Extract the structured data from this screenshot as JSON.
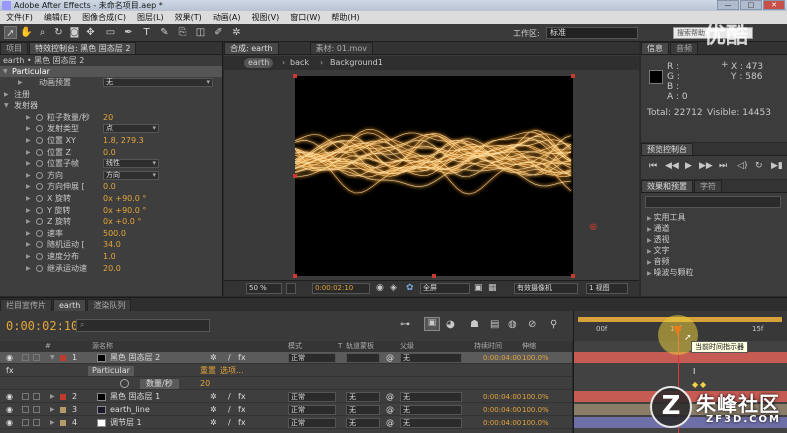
{
  "window": {
    "title": "Adobe After Effects - 未命名项目.aep *",
    "buttons": [
      "—",
      "□",
      "✕"
    ]
  },
  "menu": [
    "文件(F)",
    "编辑(E)",
    "图像合成(C)",
    "图层(L)",
    "效果(T)",
    "动画(A)",
    "视图(V)",
    "窗口(W)",
    "帮助(H)"
  ],
  "toolbar": {
    "tools": [
      "select-tool",
      "hand-tool",
      "zoom-tool",
      "rotate-tool",
      "camera-tool",
      "pan-behind-tool",
      "mask-tool",
      "pen-tool",
      "text-tool",
      "brush-tool",
      "clone-tool",
      "eraser-tool",
      "roto-brush-tool",
      "puppet-tool"
    ],
    "workspace_label": "工作区:",
    "workspace_value": "标准",
    "search_placeholder": "搜索帮助"
  },
  "effect_controls": {
    "tabs": [
      "项目",
      "特效控制台: 黑色 固态层 2"
    ],
    "subheader": "earth • 黑色 固态层 2",
    "effect_name": "Particular",
    "rows": [
      {
        "label": "动画预置",
        "value": "无",
        "kind": "dropdown"
      },
      {
        "label": "注册",
        "value": "",
        "kind": "group"
      },
      {
        "label": "发射器",
        "value": "",
        "kind": "group"
      },
      {
        "label": "粒子数量/秒",
        "value": "20",
        "kind": "value"
      },
      {
        "label": "发射类型",
        "value": "点",
        "kind": "dropdown"
      },
      {
        "label": "位置 XY",
        "value": "1.8, 279.3",
        "kind": "value"
      },
      {
        "label": "位置 Z",
        "value": "0.0",
        "kind": "value"
      },
      {
        "label": "位置子帧",
        "value": "线性",
        "kind": "dropdown"
      },
      {
        "label": "方向",
        "value": "方向",
        "kind": "dropdown"
      },
      {
        "label": "方向伸展 [",
        "value": "0.0",
        "kind": "value"
      },
      {
        "label": "X 旋转",
        "value": "0x +90.0 °",
        "kind": "value"
      },
      {
        "label": "Y 旋转",
        "value": "0x +90.0 °",
        "kind": "value"
      },
      {
        "label": "Z 旋转",
        "value": "0x +0.0 °",
        "kind": "value"
      },
      {
        "label": "速率",
        "value": "500.0",
        "kind": "value"
      },
      {
        "label": "随机运动 [",
        "value": "34.0",
        "kind": "value"
      },
      {
        "label": "速度分布",
        "value": "1.0",
        "kind": "value"
      },
      {
        "label": "继承运动速",
        "value": "20.0",
        "kind": "value"
      }
    ]
  },
  "composition": {
    "tabs": [
      "合成: earth",
      "素材: 01.mov"
    ],
    "breadcrumb": [
      "earth",
      "back",
      "Background1"
    ],
    "footer": {
      "zoom": "50 %",
      "timecode": "0:00:02:10",
      "resolution": "全屏",
      "camera": "有效摄像机",
      "views": "1 视图"
    }
  },
  "info": {
    "tabs": [
      "信息",
      "音频"
    ],
    "r": "R :",
    "g": "G :",
    "b": "B :",
    "a": "A : 0",
    "x": "X : 473",
    "y": "Y : 586",
    "total": "Total: 22712",
    "visible": "Visible: 14453"
  },
  "preview": {
    "tab": "预览控制台"
  },
  "effects_presets": {
    "tabs": [
      "效果和预置",
      "字符"
    ],
    "items": [
      "实用工具",
      "通道",
      "透视",
      "文字",
      "音频",
      "噪波与颗粒"
    ]
  },
  "timeline": {
    "tabs": [
      "栏目宣传片",
      "earth",
      "渲染队列"
    ],
    "timecode": "0:00:02:10",
    "search_placeholder": "",
    "columns": [
      "#",
      "源名称",
      "模式",
      "T",
      "轨道蒙板",
      "父级",
      "持续时间",
      "伸缩"
    ],
    "ruler": [
      "00f",
      "10f",
      "15f"
    ],
    "tooltip": "当前时间指示器",
    "layers": [
      {
        "num": "1",
        "name": "黑色 固态层 2",
        "mode": "正常",
        "track": "",
        "parent": "无",
        "duration": "0:00:04:00",
        "stretch": "100.0%",
        "color": "#c03a2e",
        "thumb": "#000000",
        "selected": true
      },
      {
        "num": "",
        "name": "Particular",
        "mode": "",
        "track": "",
        "parent": "",
        "duration": "",
        "stretch": "",
        "color": "",
        "thumb": "",
        "selected": false,
        "sub": true,
        "reset": "重置",
        "options": "选项..."
      },
      {
        "num": "",
        "name": "数量/秒",
        "mode": "",
        "track": "",
        "parent": "",
        "duration": "",
        "stretch": "",
        "color": "",
        "thumb": "",
        "selected": false,
        "prop": true,
        "value": "20"
      },
      {
        "num": "2",
        "name": "黑色 固态层 1",
        "mode": "正常",
        "track": "无",
        "parent": "无",
        "duration": "0:00:04:00",
        "stretch": "100.0%",
        "color": "#c03a2e",
        "thumb": "#000000",
        "selected": false
      },
      {
        "num": "3",
        "name": "earth_line",
        "mode": "正常",
        "track": "无",
        "parent": "无",
        "duration": "0:00:04:00",
        "stretch": "100.0%",
        "color": "#b59a6a",
        "thumb": "#1a1a2a",
        "selected": false
      },
      {
        "num": "4",
        "name": "调节层 1",
        "mode": "正常",
        "track": "无",
        "parent": "无",
        "duration": "0:00:04:00",
        "stretch": "100.0%",
        "color": "#b59a6a",
        "thumb": "#ffffff",
        "selected": false
      }
    ]
  },
  "watermark": {
    "logo": "Z",
    "text": "朱峰社区",
    "sub": "ZF3D.COM",
    "top": "优酷"
  },
  "colors": {
    "accent": "#e4a63a",
    "layer_red": "#c03a2e",
    "bar_red": "#c65b53",
    "bar_tan": "#8b7e69",
    "bar_purple": "#6f6fa8"
  }
}
